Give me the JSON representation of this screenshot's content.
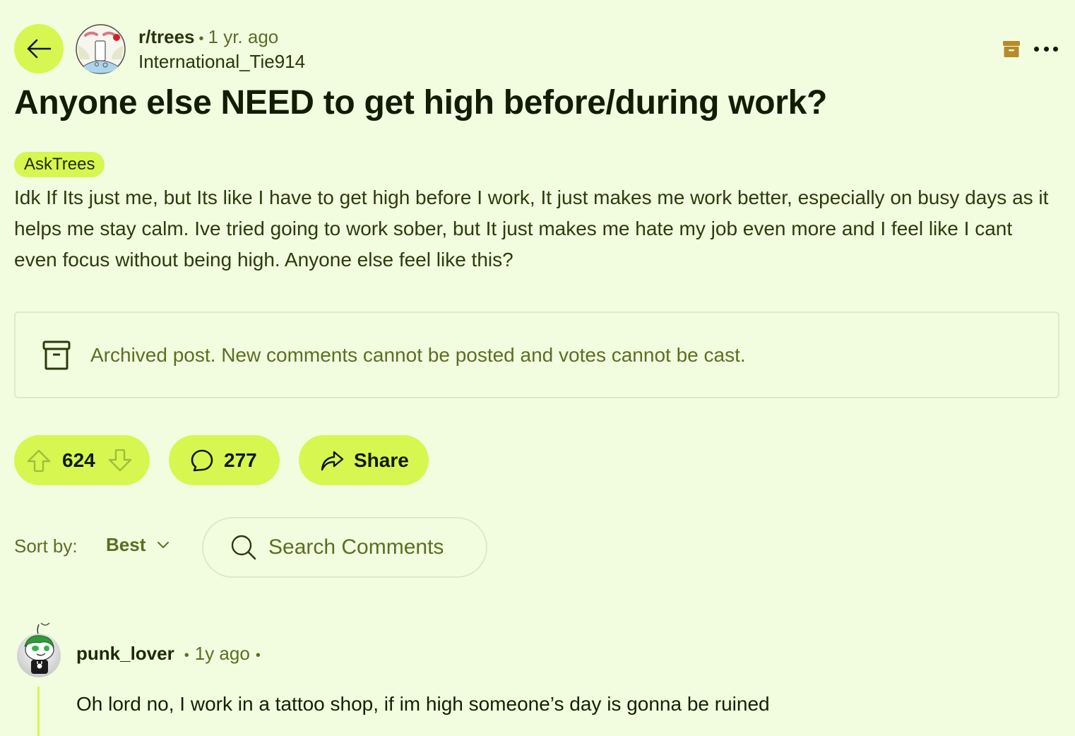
{
  "header": {
    "back_icon": "arrow-left-icon",
    "subreddit": "r/trees",
    "separator": "•",
    "time_ago": "1 yr. ago",
    "author": "International_Tie914",
    "archive_icon": "archive-box-icon",
    "more_icon": "more-horizontal-icon"
  },
  "post": {
    "title": "Anyone else NEED to get high before/during work?",
    "flair": "AskTrees",
    "body": "Idk If Its just me, but Its like I have to get high before I work, It just makes me work better, especially on busy days as it helps me stay calm. Ive tried going to work sober, but It just makes me hate my job even more and I feel like I cant even focus without being high. Anyone else feel like this?"
  },
  "archived_notice": {
    "icon": "archive-box-icon",
    "text": "Archived post. New comments cannot be posted and votes cannot be cast."
  },
  "actions": {
    "upvote_icon": "arrow-up-icon",
    "score": "624",
    "downvote_icon": "arrow-down-icon",
    "comment_icon": "speech-bubble-icon",
    "comment_count": "277",
    "share_icon": "share-arrow-icon",
    "share_label": "Share"
  },
  "comments_toolbar": {
    "sort_label": "Sort by:",
    "sort_value": "Best",
    "search_placeholder": "Search Comments"
  },
  "comments": [
    {
      "author": "punk_lover",
      "separator": "•",
      "time_ago": "1y ago",
      "trailing_separator": "•",
      "body": "Oh lord no, I work in a tattoo shop, if im high someone’s day is gonna be ruined"
    }
  ],
  "colors": {
    "background": "#f2fde0",
    "accent": "#d8f650",
    "muted_text": "#5b6e22",
    "archive_icon_top": "#b88a2a"
  }
}
